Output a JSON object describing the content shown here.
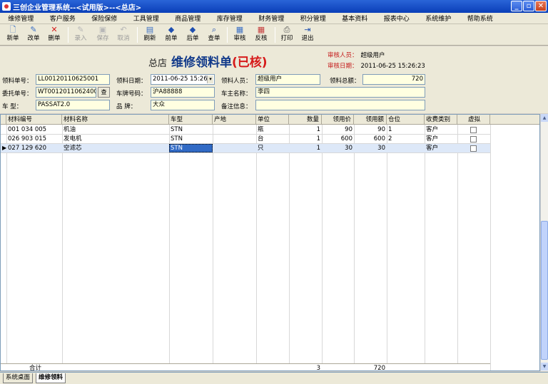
{
  "window": {
    "title": "三创企业管理系统--<试用版>--<总店>"
  },
  "menu": [
    "维修管理",
    "客户服务",
    "保险保修",
    "工具管理",
    "商品管理",
    "库存管理",
    "财务管理",
    "积分管理",
    "基本资料",
    "报表中心",
    "系统维护",
    "帮助系统"
  ],
  "toolbar": {
    "new": "新单",
    "edit": "改单",
    "delete": "删单",
    "entry": "录入",
    "save": "保存",
    "cancel": "取消",
    "refresh": "刷新",
    "prev": "前单",
    "next": "后单",
    "find": "查单",
    "audit": "审核",
    "unaudit": "反核",
    "print": "打印",
    "exit": "退出"
  },
  "header": {
    "branch": "总店",
    "doc_title": "维修领料单",
    "status": "(已核)",
    "auditor_label": "审核人员：",
    "auditor": "超级用户",
    "audit_date_label": "审核日期：",
    "audit_date": "2011-06-25 15:26:23"
  },
  "form": {
    "doc_no_label": "领料单号：",
    "doc_no": "LL00120110625001",
    "date_label": "领料日期：",
    "date": "2011-06-25 15:26:",
    "picker_label": "领料人员：",
    "picker": "超级用户",
    "total_label": "领料总额：",
    "total": "720",
    "order_no_label": "委托单号：",
    "order_no": "WT00120110624001",
    "browse": "查",
    "plate_label": "车牌号码：",
    "plate": "沪A88888",
    "owner_label": "车主名称：",
    "owner": "李四",
    "model_label": "车    型：",
    "model": "PASSAT2.0",
    "brand_label": "品    牌：",
    "brand": "大众",
    "remark_label": "备注信息：",
    "remark": ""
  },
  "table": {
    "columns": [
      "材料编号",
      "材料名称",
      "车型",
      "产地",
      "单位",
      "数量",
      "领用价",
      "领用额",
      "仓位",
      "收费类别",
      "虚拟"
    ],
    "rows": [
      {
        "code": "001 034 005",
        "name": "机油",
        "model": "STN",
        "origin": "",
        "unit": "瓶",
        "qty": "1",
        "price": "90",
        "amount": "90",
        "bin": "1",
        "charge": "客户"
      },
      {
        "code": "026 903 015",
        "name": "发电机",
        "model": "STN",
        "origin": "",
        "unit": "台",
        "qty": "1",
        "price": "600",
        "amount": "600",
        "bin": "2",
        "charge": "客户"
      },
      {
        "code": "027 129 620",
        "name": "空滤芯",
        "model": "STN",
        "origin": "",
        "unit": "只",
        "qty": "1",
        "price": "30",
        "amount": "30",
        "bin": "",
        "charge": "客户"
      }
    ],
    "total_label": "合计",
    "total_qty": "3",
    "total_amount": "720"
  },
  "tabs": [
    "系统桌面",
    "维修领料"
  ]
}
